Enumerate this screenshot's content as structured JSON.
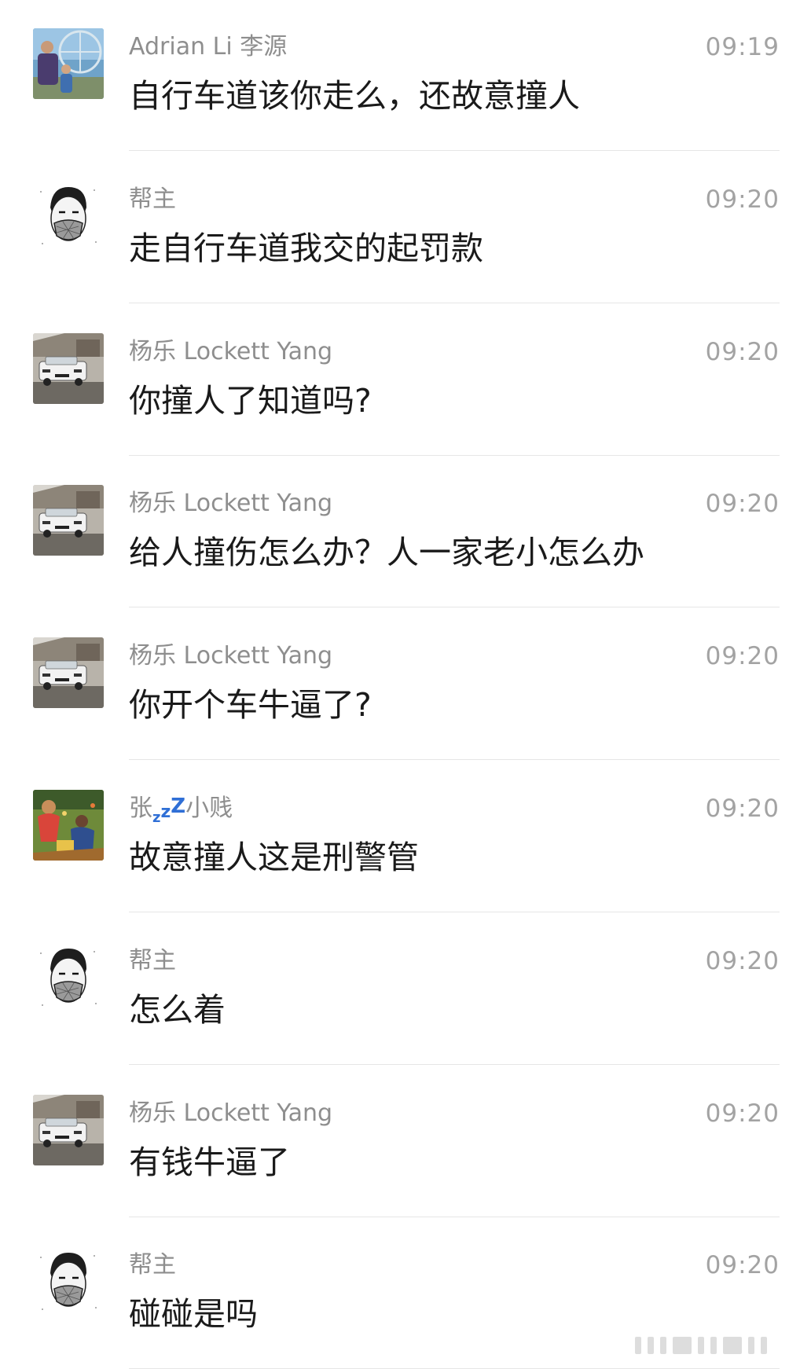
{
  "messages": [
    {
      "sender": "Adrian Li 李源",
      "time": "09:19",
      "text": "自行车道该你走么，还故意撞人",
      "avatar": "photo-ferris-wheel"
    },
    {
      "sender": "帮主",
      "time": "09:20",
      "text": "走自行车道我交的起罚款",
      "avatar": "sketch-masked-man"
    },
    {
      "sender": "杨乐 Lockett Yang",
      "time": "09:20",
      "text": "你撞人了知道吗?",
      "avatar": "photo-white-car"
    },
    {
      "sender": "杨乐 Lockett Yang",
      "time": "09:20",
      "text": "给人撞伤怎么办？人一家老小怎么办",
      "avatar": "photo-white-car"
    },
    {
      "sender": "杨乐 Lockett Yang",
      "time": "09:20",
      "text": "你开个车牛逼了?",
      "avatar": "photo-white-car"
    },
    {
      "sender": "张",
      "sender_suffix": "小贱",
      "sleep_z": [
        "z",
        "z",
        "Z"
      ],
      "time": "09:20",
      "text": "故意撞人这是刑警管",
      "avatar": "painting-figures"
    },
    {
      "sender": "帮主",
      "time": "09:20",
      "text": "怎么着",
      "avatar": "sketch-masked-man"
    },
    {
      "sender": "杨乐 Lockett Yang",
      "time": "09:20",
      "text": "有钱牛逼了",
      "avatar": "photo-white-car"
    },
    {
      "sender": "帮主",
      "time": "09:20",
      "text": "碰碰是吗",
      "avatar": "sketch-masked-man"
    }
  ],
  "colors": {
    "sender": "#8e8e8e",
    "time": "#a3a3a3",
    "message_text": "#1a1a1a",
    "divider": "#e6e6e6",
    "sleep_z": "#2f6fd6"
  }
}
